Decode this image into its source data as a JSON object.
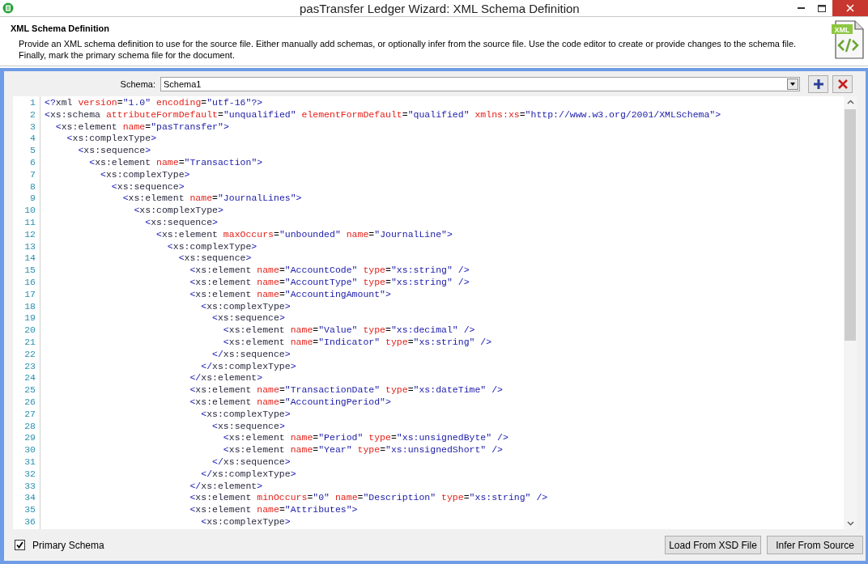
{
  "window": {
    "title": "pasTransfer Ledger Wizard: XML Schema Definition"
  },
  "header": {
    "title": "XML Schema Definition",
    "description": "Provide an XML schema definition to use for the source file.  Either manually add schemas, or optionally infer from the source file.  Use the code editor to create or provide changes to the schema file.  Finally, mark the primary schema file for the document.",
    "icon_label": "XML"
  },
  "schema": {
    "label": "Schema:",
    "value": "Schema1"
  },
  "editor": {
    "lines": [
      {
        "number": "1",
        "text": "<?xml version=\"1.0\" encoding=\"utf-16\"?>"
      },
      {
        "number": "2",
        "text": "<xs:schema attributeFormDefault=\"unqualified\" elementFormDefault=\"qualified\" xmlns:xs=\"http://www.w3.org/2001/XMLSchema\">"
      },
      {
        "number": "3",
        "text": "  <xs:element name=\"pasTransfer\">"
      },
      {
        "number": "4",
        "text": "    <xs:complexType>"
      },
      {
        "number": "5",
        "text": "      <xs:sequence>"
      },
      {
        "number": "6",
        "text": "        <xs:element name=\"Transaction\">"
      },
      {
        "number": "7",
        "text": "          <xs:complexType>"
      },
      {
        "number": "8",
        "text": "            <xs:sequence>"
      },
      {
        "number": "9",
        "text": "              <xs:element name=\"JournalLines\">"
      },
      {
        "number": "10",
        "text": "                <xs:complexType>"
      },
      {
        "number": "11",
        "text": "                  <xs:sequence>"
      },
      {
        "number": "12",
        "text": "                    <xs:element maxOccurs=\"unbounded\" name=\"JournalLine\">"
      },
      {
        "number": "13",
        "text": "                      <xs:complexType>"
      },
      {
        "number": "14",
        "text": "                        <xs:sequence>"
      },
      {
        "number": "15",
        "text": "                          <xs:element name=\"AccountCode\" type=\"xs:string\" />"
      },
      {
        "number": "16",
        "text": "                          <xs:element name=\"AccountType\" type=\"xs:string\" />"
      },
      {
        "number": "17",
        "text": "                          <xs:element name=\"AccountingAmount\">"
      },
      {
        "number": "18",
        "text": "                            <xs:complexType>"
      },
      {
        "number": "19",
        "text": "                              <xs:sequence>"
      },
      {
        "number": "20",
        "text": "                                <xs:element name=\"Value\" type=\"xs:decimal\" />"
      },
      {
        "number": "21",
        "text": "                                <xs:element name=\"Indicator\" type=\"xs:string\" />"
      },
      {
        "number": "22",
        "text": "                              </xs:sequence>"
      },
      {
        "number": "23",
        "text": "                            </xs:complexType>"
      },
      {
        "number": "24",
        "text": "                          </xs:element>"
      },
      {
        "number": "25",
        "text": "                          <xs:element name=\"TransactionDate\" type=\"xs:dateTime\" />"
      },
      {
        "number": "26",
        "text": "                          <xs:element name=\"AccountingPeriod\">"
      },
      {
        "number": "27",
        "text": "                            <xs:complexType>"
      },
      {
        "number": "28",
        "text": "                              <xs:sequence>"
      },
      {
        "number": "29",
        "text": "                                <xs:element name=\"Period\" type=\"xs:unsignedByte\" />"
      },
      {
        "number": "30",
        "text": "                                <xs:element name=\"Year\" type=\"xs:unsignedShort\" />"
      },
      {
        "number": "31",
        "text": "                              </xs:sequence>"
      },
      {
        "number": "32",
        "text": "                            </xs:complexType>"
      },
      {
        "number": "33",
        "text": "                          </xs:element>"
      },
      {
        "number": "34",
        "text": "                          <xs:element minOccurs=\"0\" name=\"Description\" type=\"xs:string\" />"
      },
      {
        "number": "35",
        "text": "                          <xs:element name=\"Attributes\">"
      },
      {
        "number": "36",
        "text": "                            <xs:complexType>"
      }
    ]
  },
  "primary_schema": {
    "label": "Primary Schema",
    "checked": true
  },
  "buttons": [
    "Load From XSD File",
    "Infer From Source"
  ]
}
